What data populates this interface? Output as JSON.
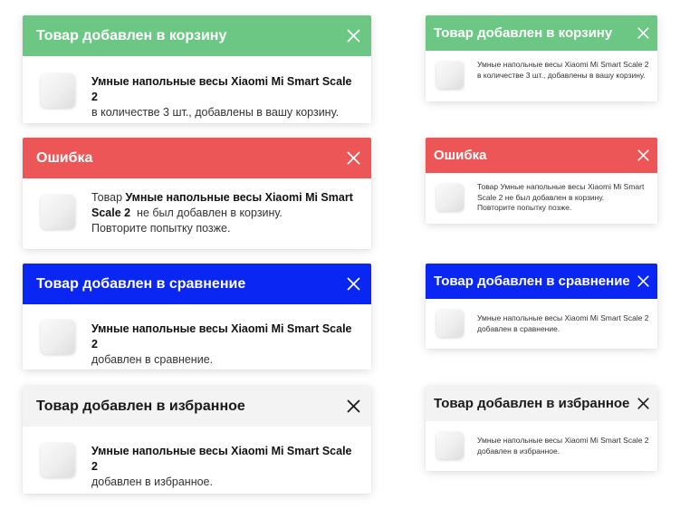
{
  "colors": {
    "success": "#6cc784",
    "error": "#ec5657",
    "compare": "#0a26f2",
    "favorite_header": "#f3f3f4"
  },
  "icons": {
    "close": "close-icon",
    "product": "product-thumbnail"
  },
  "cart": {
    "title": "Товар добавлен в корзину",
    "product": "Умные напольные весы Xiaomi Mi Smart Scale 2",
    "text": "в количестве 3 шт., добавлены в вашу корзину."
  },
  "error": {
    "title": "Ошибка",
    "prefix": "Товар",
    "product": "Умные напольные весы Xiaomi Mi Smart Scale 2",
    "text": "не был добавлен в корзину.",
    "retry": "Повторите попытку позже."
  },
  "compare": {
    "title": "Товар добавлен в сравнение",
    "product": "Умные напольные весы Xiaomi Mi Smart Scale 2",
    "text": "добавлен в сравнение."
  },
  "favorite": {
    "title": "Товар добавлен в избранное",
    "product": "Умные напольные весы Xiaomi Mi Smart Scale 2",
    "text": "добавлен в избранное."
  }
}
